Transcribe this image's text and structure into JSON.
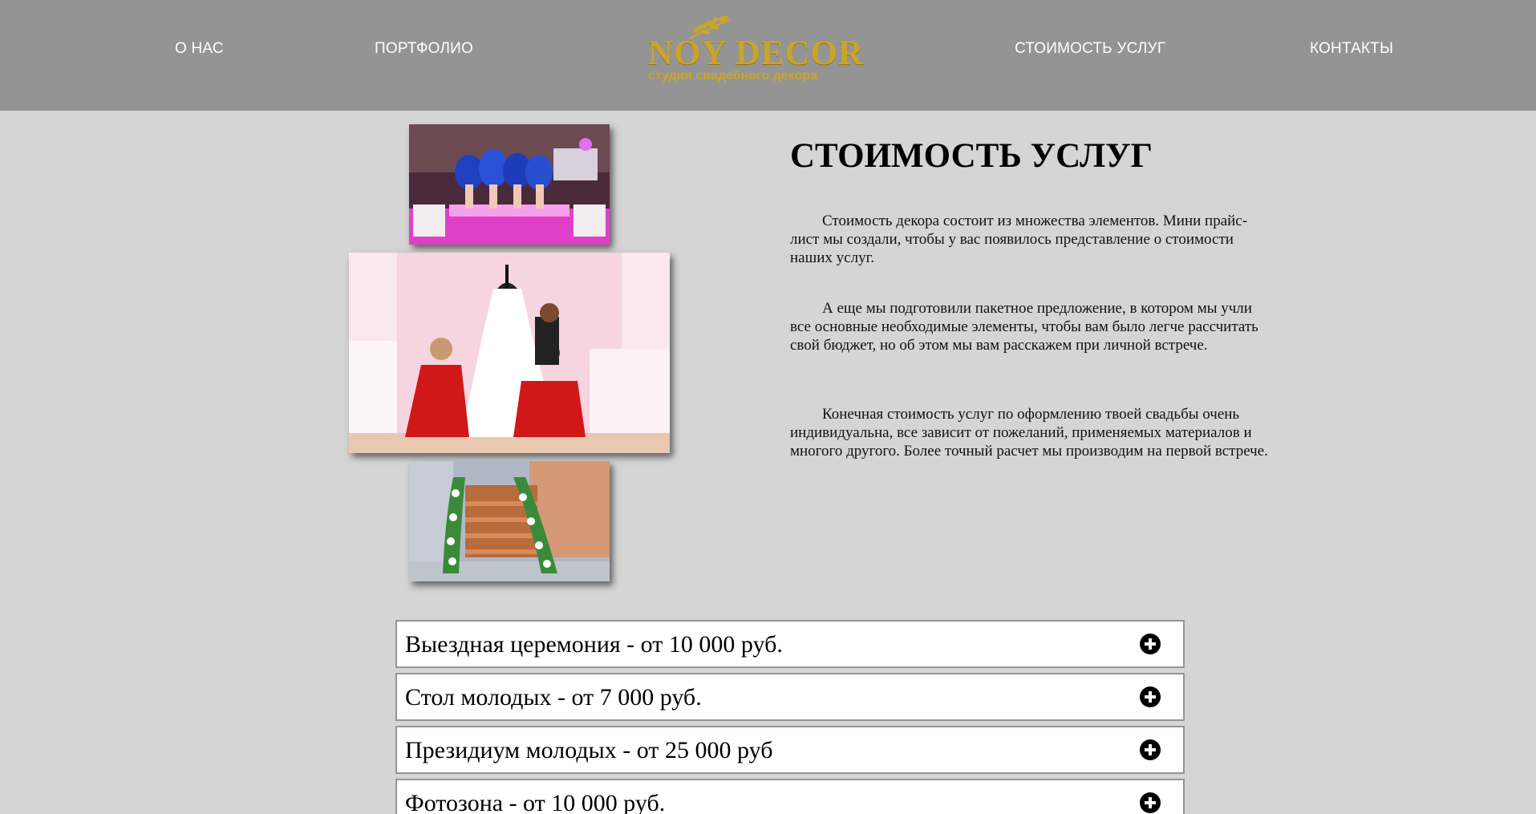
{
  "nav": {
    "about": "О НАС",
    "portfolio": "ПОРТФОЛИО",
    "prices": "СТОИМОСТЬ УСЛУГ",
    "contacts": "КОНТАКТЫ"
  },
  "logo": {
    "title": "NOY DECOR",
    "subtitle": "студия свадебного декора"
  },
  "photos": [
    {
      "icon": "stage-dancers-photo"
    },
    {
      "icon": "wedding-dress-photo"
    },
    {
      "icon": "staircase-flowers-photo"
    }
  ],
  "main": {
    "title": "СТОИМОСТЬ УСЛУГ",
    "paragraphs": [
      "Стоимость декора состоит из множества элементов. Мини прайс-лист мы создали, чтобы у вас появилось представление о стоимости наших услуг.",
      "А еще мы подготовили пакетное предложение, в котором мы учли все основные необходимые элементы, чтобы вам было легче рассчитать свой бюджет, но об этом мы вам расскажем при личной встрече.",
      "Конечная стоимость услуг по оформлению твоей свадьбы очень индивидуальна, все зависит от пожеланий, применяемых материалов и многого другого. Более точный расчет мы производим на первой встрече."
    ]
  },
  "accordion": [
    {
      "label": "Выездная церемония - от 10 000 руб.",
      "icon": "plus-circle-icon"
    },
    {
      "label": "Стол молодых - от 7 000 руб.",
      "icon": "plus-circle-icon"
    },
    {
      "label": "Президиум молодых - от 25 000 руб",
      "icon": "plus-circle-icon"
    },
    {
      "label": "Фотозона - от 10 000 руб.",
      "icon": "plus-circle-icon"
    }
  ],
  "colors": {
    "header_bg": "#949494",
    "page_bg": "#d5d5d5",
    "logo_gold": "#c9a52c"
  }
}
